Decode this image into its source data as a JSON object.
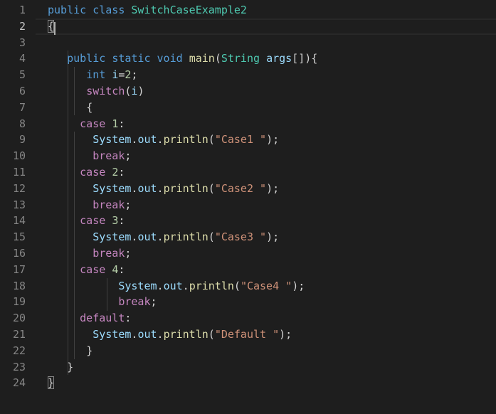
{
  "editor": {
    "active_line": 2,
    "line_numbers": [
      "1",
      "2",
      "3",
      "4",
      "5",
      "6",
      "7",
      "8",
      "9",
      "10",
      "11",
      "12",
      "13",
      "14",
      "15",
      "16",
      "17",
      "18",
      "19",
      "20",
      "21",
      "22",
      "23",
      "24"
    ],
    "lines": [
      [
        {
          "t": "public",
          "c": "kw"
        },
        {
          "t": " ",
          "c": "pn"
        },
        {
          "t": "class",
          "c": "kw"
        },
        {
          "t": " ",
          "c": "pn"
        },
        {
          "t": "SwitchCaseExample2",
          "c": "ty"
        }
      ],
      [
        {
          "t": "{",
          "c": "pn bm"
        }
      ],
      [],
      [
        {
          "t": "   ",
          "c": "pn"
        },
        {
          "t": "public",
          "c": "kw"
        },
        {
          "t": " ",
          "c": "pn"
        },
        {
          "t": "static",
          "c": "kw"
        },
        {
          "t": " ",
          "c": "pn"
        },
        {
          "t": "void",
          "c": "kw"
        },
        {
          "t": " ",
          "c": "pn"
        },
        {
          "t": "main",
          "c": "fn"
        },
        {
          "t": "(",
          "c": "pn"
        },
        {
          "t": "String",
          "c": "ty"
        },
        {
          "t": " ",
          "c": "pn"
        },
        {
          "t": "args",
          "c": "id"
        },
        {
          "t": "[]){",
          "c": "pn"
        }
      ],
      [
        {
          "t": "      ",
          "c": "pn"
        },
        {
          "t": "int",
          "c": "kw"
        },
        {
          "t": " ",
          "c": "pn"
        },
        {
          "t": "i",
          "c": "id"
        },
        {
          "t": "=",
          "c": "pn"
        },
        {
          "t": "2",
          "c": "num"
        },
        {
          "t": ";",
          "c": "pn"
        }
      ],
      [
        {
          "t": "      ",
          "c": "pn"
        },
        {
          "t": "switch",
          "c": "ctl"
        },
        {
          "t": "(",
          "c": "pn"
        },
        {
          "t": "i",
          "c": "id"
        },
        {
          "t": ")",
          "c": "pn"
        }
      ],
      [
        {
          "t": "      ",
          "c": "pn"
        },
        {
          "t": "{",
          "c": "pn"
        }
      ],
      [
        {
          "t": "     ",
          "c": "pn"
        },
        {
          "t": "case",
          "c": "ctl"
        },
        {
          "t": " ",
          "c": "pn"
        },
        {
          "t": "1",
          "c": "num"
        },
        {
          "t": ":",
          "c": "pn"
        }
      ],
      [
        {
          "t": "       ",
          "c": "pn"
        },
        {
          "t": "System",
          "c": "id"
        },
        {
          "t": ".",
          "c": "pn"
        },
        {
          "t": "out",
          "c": "id"
        },
        {
          "t": ".",
          "c": "pn"
        },
        {
          "t": "println",
          "c": "fn"
        },
        {
          "t": "(",
          "c": "pn"
        },
        {
          "t": "\"Case1 \"",
          "c": "str"
        },
        {
          "t": ");",
          "c": "pn"
        }
      ],
      [
        {
          "t": "       ",
          "c": "pn"
        },
        {
          "t": "break",
          "c": "ctl"
        },
        {
          "t": ";",
          "c": "pn"
        }
      ],
      [
        {
          "t": "     ",
          "c": "pn"
        },
        {
          "t": "case",
          "c": "ctl"
        },
        {
          "t": " ",
          "c": "pn"
        },
        {
          "t": "2",
          "c": "num"
        },
        {
          "t": ":",
          "c": "pn"
        }
      ],
      [
        {
          "t": "       ",
          "c": "pn"
        },
        {
          "t": "System",
          "c": "id"
        },
        {
          "t": ".",
          "c": "pn"
        },
        {
          "t": "out",
          "c": "id"
        },
        {
          "t": ".",
          "c": "pn"
        },
        {
          "t": "println",
          "c": "fn"
        },
        {
          "t": "(",
          "c": "pn"
        },
        {
          "t": "\"Case2 \"",
          "c": "str"
        },
        {
          "t": ");",
          "c": "pn"
        }
      ],
      [
        {
          "t": "       ",
          "c": "pn"
        },
        {
          "t": "break",
          "c": "ctl"
        },
        {
          "t": ";",
          "c": "pn"
        }
      ],
      [
        {
          "t": "     ",
          "c": "pn"
        },
        {
          "t": "case",
          "c": "ctl"
        },
        {
          "t": " ",
          "c": "pn"
        },
        {
          "t": "3",
          "c": "num"
        },
        {
          "t": ":",
          "c": "pn"
        }
      ],
      [
        {
          "t": "       ",
          "c": "pn"
        },
        {
          "t": "System",
          "c": "id"
        },
        {
          "t": ".",
          "c": "pn"
        },
        {
          "t": "out",
          "c": "id"
        },
        {
          "t": ".",
          "c": "pn"
        },
        {
          "t": "println",
          "c": "fn"
        },
        {
          "t": "(",
          "c": "pn"
        },
        {
          "t": "\"Case3 \"",
          "c": "str"
        },
        {
          "t": ");",
          "c": "pn"
        }
      ],
      [
        {
          "t": "       ",
          "c": "pn"
        },
        {
          "t": "break",
          "c": "ctl"
        },
        {
          "t": ";",
          "c": "pn"
        }
      ],
      [
        {
          "t": "     ",
          "c": "pn"
        },
        {
          "t": "case",
          "c": "ctl"
        },
        {
          "t": " ",
          "c": "pn"
        },
        {
          "t": "4",
          "c": "num"
        },
        {
          "t": ":",
          "c": "pn"
        }
      ],
      [
        {
          "t": "           ",
          "c": "pn"
        },
        {
          "t": "System",
          "c": "id"
        },
        {
          "t": ".",
          "c": "pn"
        },
        {
          "t": "out",
          "c": "id"
        },
        {
          "t": ".",
          "c": "pn"
        },
        {
          "t": "println",
          "c": "fn"
        },
        {
          "t": "(",
          "c": "pn"
        },
        {
          "t": "\"Case4 \"",
          "c": "str"
        },
        {
          "t": ");",
          "c": "pn"
        }
      ],
      [
        {
          "t": "           ",
          "c": "pn"
        },
        {
          "t": "break",
          "c": "ctl"
        },
        {
          "t": ";",
          "c": "pn"
        }
      ],
      [
        {
          "t": "     ",
          "c": "pn"
        },
        {
          "t": "default",
          "c": "ctl"
        },
        {
          "t": ":",
          "c": "pn"
        }
      ],
      [
        {
          "t": "       ",
          "c": "pn"
        },
        {
          "t": "System",
          "c": "id"
        },
        {
          "t": ".",
          "c": "pn"
        },
        {
          "t": "out",
          "c": "id"
        },
        {
          "t": ".",
          "c": "pn"
        },
        {
          "t": "println",
          "c": "fn"
        },
        {
          "t": "(",
          "c": "pn"
        },
        {
          "t": "\"Default \"",
          "c": "str"
        },
        {
          "t": ");",
          "c": "pn"
        }
      ],
      [
        {
          "t": "      ",
          "c": "pn"
        },
        {
          "t": "}",
          "c": "pn"
        }
      ],
      [
        {
          "t": "   ",
          "c": "pn"
        },
        {
          "t": "}",
          "c": "pn"
        }
      ],
      [
        {
          "t": "}",
          "c": "pn bm"
        }
      ]
    ]
  }
}
